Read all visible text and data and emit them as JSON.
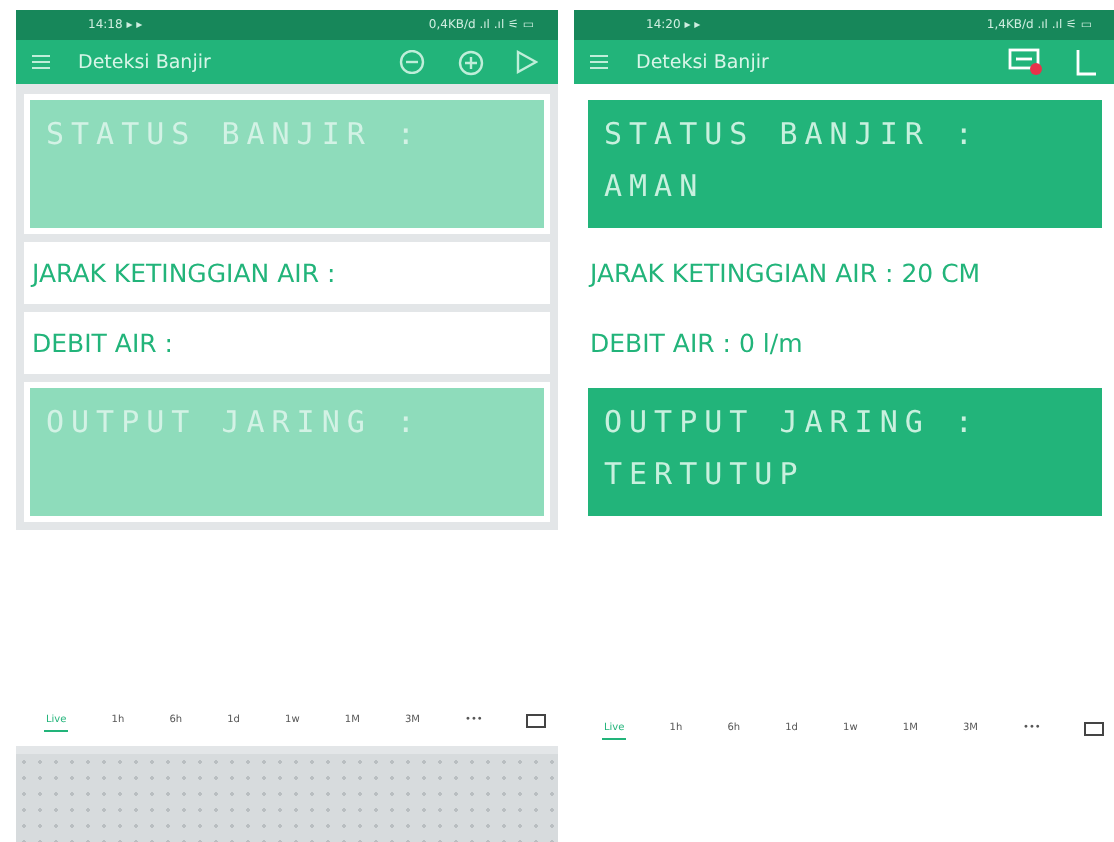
{
  "screens": [
    {
      "status_time": "14:18 ▸ ▸",
      "status_network": "0,4KB/d .ıl .ıl ⚟ ▭",
      "title": "Deteksi Banjir",
      "edit_mode": true,
      "widgets": [
        {
          "kind": "lcd",
          "lines": [
            "STATUS BANJIR :"
          ]
        },
        {
          "kind": "label",
          "text": "JARAK KETINGGIAN AIR :"
        },
        {
          "kind": "label",
          "text": "DEBIT AIR :"
        },
        {
          "kind": "lcd",
          "lines": [
            "OUTPUT JARING :"
          ]
        }
      ],
      "tabs": [
        {
          "label": "Live",
          "selected": true
        },
        {
          "label": "1h",
          "selected": false
        },
        {
          "label": "6h",
          "selected": false
        },
        {
          "label": "1d",
          "selected": false
        },
        {
          "label": "1w",
          "selected": false
        },
        {
          "label": "1M",
          "selected": false
        },
        {
          "label": "3M",
          "selected": false
        },
        {
          "label": "•••",
          "selected": false
        }
      ]
    },
    {
      "status_time": "14:20 ▸ ▸",
      "status_network": "1,4KB/d .ıl .ıl ⚟ ▭",
      "title": "Deteksi Banjir",
      "edit_mode": false,
      "widgets": [
        {
          "kind": "lcd",
          "lines": [
            "STATUS BANJIR :",
            "AMAN"
          ]
        },
        {
          "kind": "label",
          "text": "JARAK KETINGGIAN AIR : 20 CM"
        },
        {
          "kind": "label",
          "text": "DEBIT AIR : 0 l/m"
        },
        {
          "kind": "lcd",
          "lines": [
            "OUTPUT JARING :",
            "TERTUTUP"
          ]
        }
      ],
      "tabs": [
        {
          "label": "Live",
          "selected": true
        },
        {
          "label": "1h",
          "selected": false
        },
        {
          "label": "6h",
          "selected": false
        },
        {
          "label": "1d",
          "selected": false
        },
        {
          "label": "1w",
          "selected": false
        },
        {
          "label": "1M",
          "selected": false
        },
        {
          "label": "3M",
          "selected": false
        },
        {
          "label": "•••",
          "selected": false
        }
      ]
    }
  ]
}
